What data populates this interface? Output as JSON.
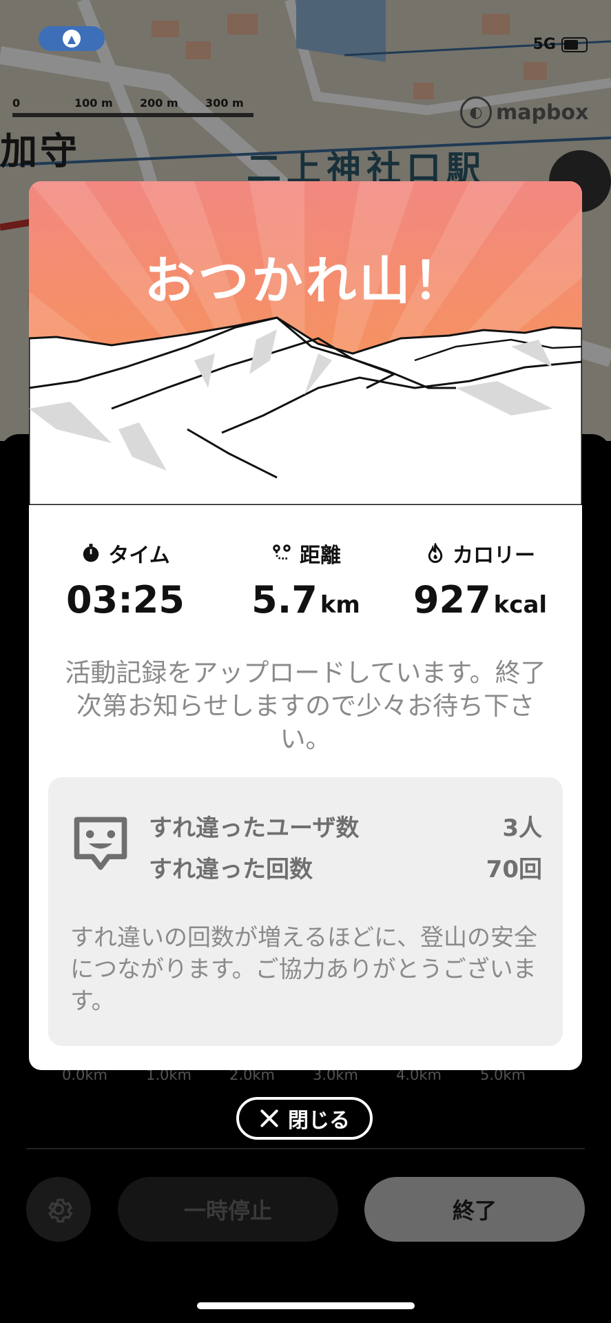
{
  "status": {
    "network": "5G"
  },
  "map": {
    "scale_labels": [
      "0",
      "100 m",
      "200 m",
      "300 m"
    ],
    "attribution": "mapbox",
    "station_label": "二上神社口駅",
    "place_label": "加守"
  },
  "modal": {
    "title": "おつかれ山！",
    "stats": [
      {
        "icon": "stopwatch-icon",
        "label": "タイム",
        "value": "03:25",
        "unit": ""
      },
      {
        "icon": "route-icon",
        "label": "距離",
        "value": "5.7",
        "unit": "km"
      },
      {
        "icon": "flame-icon",
        "label": "カロリー",
        "value": "927",
        "unit": "kcal"
      }
    ],
    "upload_message": "活動記録をアップロードしています。終了次第お知らせしますので少々お待ち下さい。",
    "passing": {
      "users_label": "すれ違ったユーザ数",
      "users_value": "3人",
      "count_label": "すれ違った回数",
      "count_value": "70回",
      "note": "すれ違いの回数が増えるほどに、登山の安全につながります。ご協力ありがとうございます。"
    }
  },
  "distance_axis": [
    "0.0km",
    "1.0km",
    "2.0km",
    "3.0km",
    "4.0km",
    "5.0km"
  ],
  "buttons": {
    "close": "閉じる",
    "pause": "一時停止",
    "end": "終了"
  },
  "colors": {
    "hero_top": "#f08a7e",
    "hero_bottom": "#f79a4c",
    "stat_text": "#111111",
    "muted_text": "#8a8a8a"
  }
}
